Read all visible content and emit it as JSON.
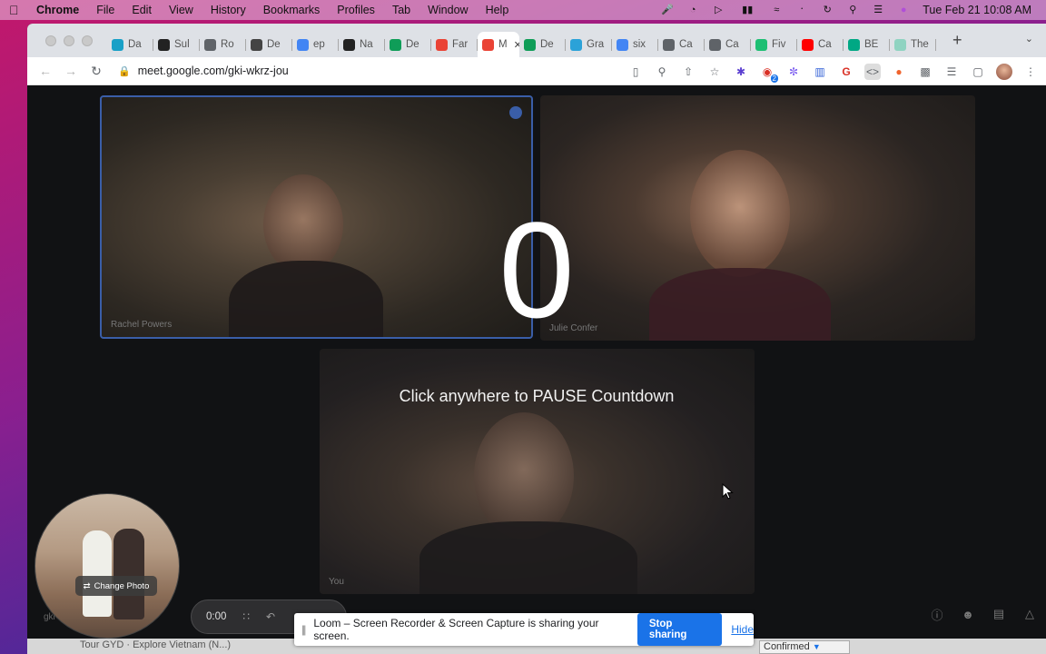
{
  "menubar": {
    "app_name": "Chrome",
    "items": [
      "File",
      "Edit",
      "View",
      "History",
      "Bookmarks",
      "Profiles",
      "Tab",
      "Window",
      "Help"
    ],
    "clock": "Tue Feb 21  10:08 AM"
  },
  "tabs": [
    {
      "label": "Da",
      "color": "#18a0c7"
    },
    {
      "label": "Sul",
      "color": "#222222"
    },
    {
      "label": "Ro",
      "color": "#5f6368"
    },
    {
      "label": "De",
      "color": "#444444"
    },
    {
      "label": "ep",
      "color": "#4285f4"
    },
    {
      "label": "Na",
      "color": "#222222"
    },
    {
      "label": "De",
      "color": "#0f9d58"
    },
    {
      "label": "Far",
      "color": "#ea4335"
    },
    {
      "label": "M",
      "color": "#ea4335",
      "active": true
    },
    {
      "label": "De",
      "color": "#0f9d58"
    },
    {
      "label": "Gra",
      "color": "#2ba2d8"
    },
    {
      "label": "six",
      "color": "#4285f4"
    },
    {
      "label": "Ca",
      "color": "#5f6368"
    },
    {
      "label": "Ca",
      "color": "#5f6368"
    },
    {
      "label": "Fiv",
      "color": "#1dbf73"
    },
    {
      "label": "Ca",
      "color": "#ff0000"
    },
    {
      "label": "BE",
      "color": "#00a884"
    },
    {
      "label": "The",
      "color": "#8fd3c1"
    }
  ],
  "toolbar": {
    "url": "meet.google.com/gki-wkrz-jou",
    "extension_badge": "2"
  },
  "meet": {
    "participants": [
      {
        "name": "Rachel Powers"
      },
      {
        "name": "Julie Confer"
      },
      {
        "name": "You"
      }
    ],
    "countdown_value": "0",
    "pause_text": "Click anywhere to PAUSE Countdown",
    "meeting_code_fragment": "gki"
  },
  "loom": {
    "change_photo_label": "Change Photo",
    "timer": "0:00",
    "share_message": "Loom – Screen Recorder & Screen Capture is sharing your screen.",
    "stop_label": "Stop sharing",
    "hide_label": "Hide"
  },
  "underpage": {
    "text": "Tour     GYD · Explore Vietnam (N...)",
    "status": "Confirmed"
  }
}
